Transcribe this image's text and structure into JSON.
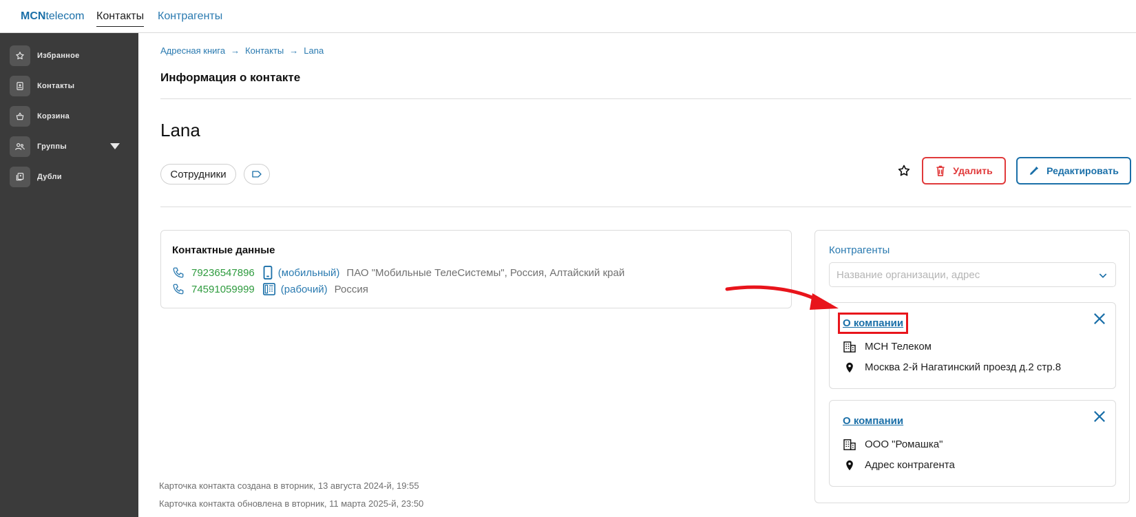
{
  "topbar": {
    "logo_bold": "MCN",
    "logo_rest": "telecom",
    "nav_contacts": "Контакты",
    "nav_agents": "Контрагенты"
  },
  "sidebar": {
    "items": [
      {
        "label": "Избранное",
        "icon": "star-icon"
      },
      {
        "label": "Контакты",
        "icon": "contact-card-icon"
      },
      {
        "label": "Корзина",
        "icon": "basket-icon"
      },
      {
        "label": "Группы",
        "icon": "people-icon"
      },
      {
        "label": "Дубли",
        "icon": "duplicates-icon"
      }
    ]
  },
  "breadcrumb": [
    "Адресная книга",
    "Контакты",
    "Lana"
  ],
  "page_title": "Информация о контакте",
  "contact": {
    "name": "Lana",
    "group_chip": "Сотрудники",
    "delete_label": "Удалить",
    "edit_label": "Редактировать"
  },
  "contact_data": {
    "title": "Контактные данные",
    "phones": [
      {
        "number": "79236547896",
        "type": "(мобильный)",
        "operator": "ПАО \"Мобильные ТелеСистемы\", Россия, Алтайский край",
        "device_icon": "mobile-phone-icon"
      },
      {
        "number": "74591059999",
        "type": "(рабочий)",
        "operator": "Россия",
        "device_icon": "desk-phone-icon"
      }
    ]
  },
  "meta": {
    "created": "Карточка контакта создана в вторник, 13 августа 2024-й, 19:55",
    "updated": "Карточка контакта обновлена в вторник, 11 марта 2025-й, 23:50"
  },
  "agents": {
    "label": "Контрагенты",
    "search_placeholder": "Название организации, адрес",
    "companies": [
      {
        "about": "О компании",
        "name": "МСН Телеком",
        "address": "Москва 2-й Нагатинский проезд д.2 стр.8"
      },
      {
        "about": "О компании",
        "name": "ООО \"Ромашка\"",
        "address": "Адрес контрагента"
      }
    ]
  },
  "colors": {
    "accent": "#1a6fa8",
    "phone_green": "#2e9b3e",
    "delete_red": "#e0393a",
    "sidebar_bg": "#3b3b3b",
    "annotation_red": "#e8141b"
  }
}
